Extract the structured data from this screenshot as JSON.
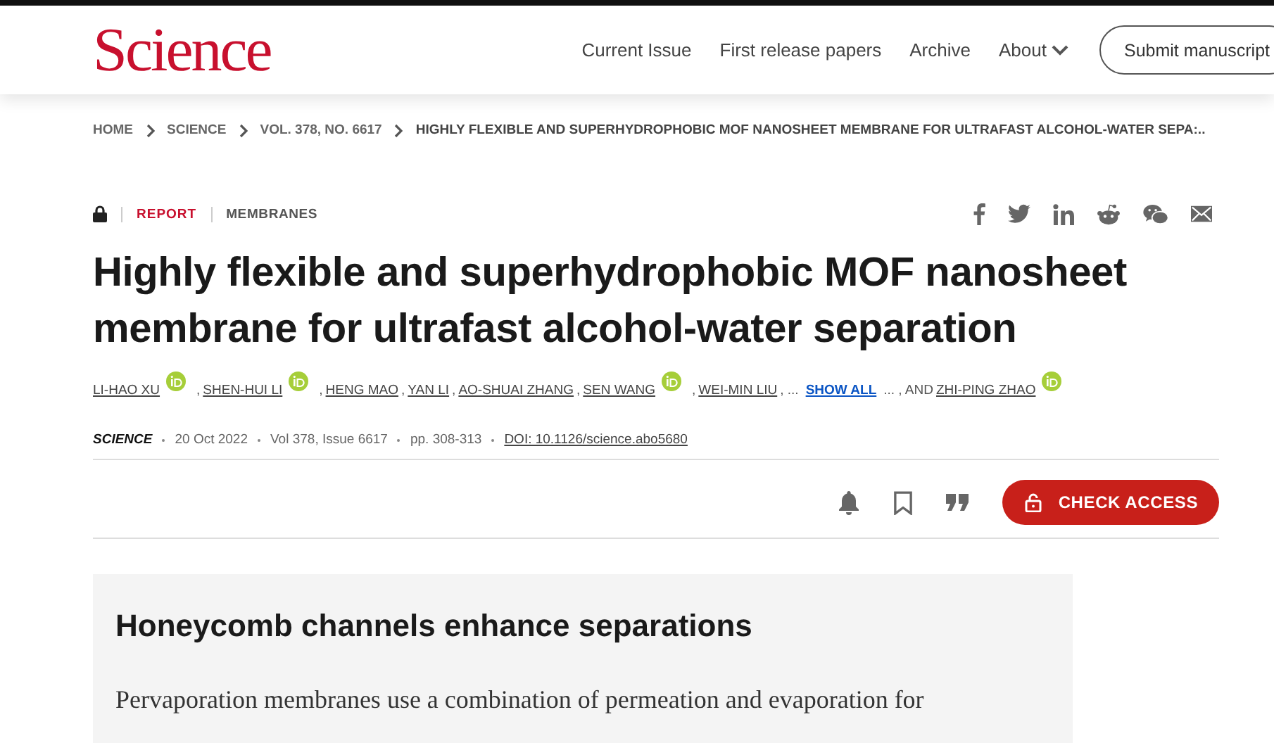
{
  "header": {
    "logo": "Science",
    "nav": [
      {
        "label": "Current Issue",
        "kind": "link"
      },
      {
        "label": "First release papers",
        "kind": "link"
      },
      {
        "label": "Archive",
        "kind": "link"
      },
      {
        "label": "About",
        "kind": "dropdown"
      }
    ],
    "submit": "Submit manuscript"
  },
  "breadcrumb": [
    "HOME",
    "SCIENCE",
    "VOL. 378, NO. 6617",
    "HIGHLY FLEXIBLE AND SUPERHYDROPHOBIC MOF NANOSHEET MEMBRANE FOR ULTRAFAST ALCOHOL-WATER SEPA:.."
  ],
  "article": {
    "locked": true,
    "type": "REPORT",
    "section": "MEMBRANES",
    "title": "Highly flexible and superhydrophobic MOF nanosheet membrane for ultrafast alcohol-water separation",
    "authors": [
      {
        "kind": "author",
        "text": "LI-HAO XU",
        "orcid": true
      },
      {
        "kind": "text",
        "text": ","
      },
      {
        "kind": "author",
        "text": "SHEN-HUI LI",
        "orcid": true
      },
      {
        "kind": "text",
        "text": ","
      },
      {
        "kind": "author",
        "text": "HENG MAO",
        "orcid": false
      },
      {
        "kind": "text",
        "text": ","
      },
      {
        "kind": "author",
        "text": "YAN LI",
        "orcid": false
      },
      {
        "kind": "text",
        "text": ","
      },
      {
        "kind": "author",
        "text": "AO-SHUAI ZHANG",
        "orcid": false
      },
      {
        "kind": "text",
        "text": ","
      },
      {
        "kind": "author",
        "text": "SEN WANG",
        "orcid": true
      },
      {
        "kind": "text",
        "text": ","
      },
      {
        "kind": "author",
        "text": "WEI-MIN LIU",
        "orcid": false
      },
      {
        "kind": "text",
        "text": ", ..."
      },
      {
        "kind": "link",
        "text": "SHOW ALL"
      },
      {
        "kind": "text",
        "text": "... , AND"
      },
      {
        "kind": "author",
        "text": "ZHI-PING ZHAO",
        "orcid": true
      }
    ],
    "meta": {
      "journal": "SCIENCE",
      "date": "20 Oct 2022",
      "issue": "Vol 378, Issue 6617",
      "pages": "pp. 308-313",
      "doi": "DOI: 10.1126/science.abo5680"
    },
    "check_access": "CHECK ACCESS"
  },
  "summary": {
    "heading": "Honeycomb channels enhance separations",
    "text": "Pervaporation membranes use a combination of permeation and evaporation for"
  }
}
